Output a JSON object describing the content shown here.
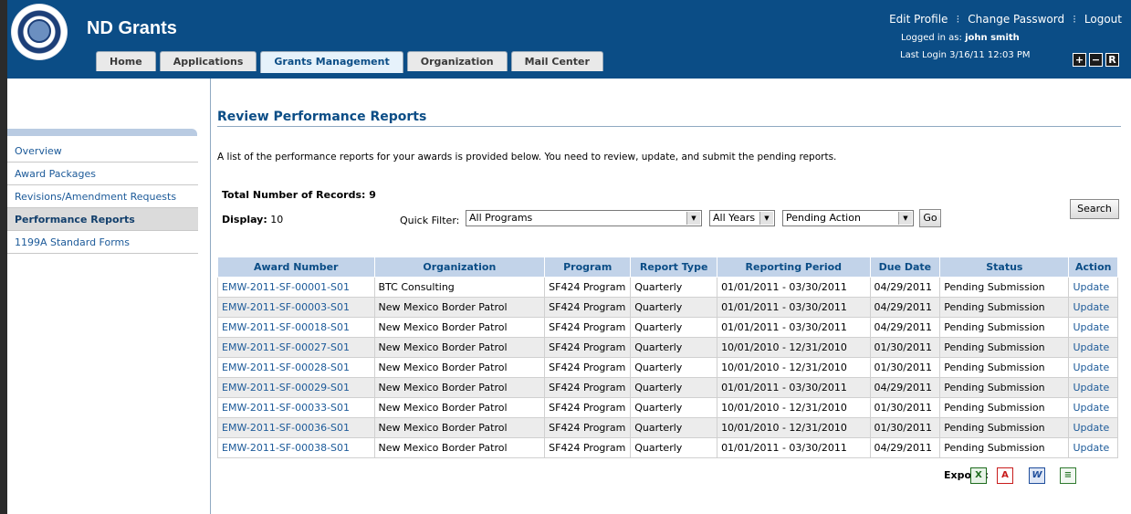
{
  "header": {
    "app_title": "ND Grants",
    "tabs": [
      {
        "label": "Home"
      },
      {
        "label": "Applications"
      },
      {
        "label": "Grants Management"
      },
      {
        "label": "Organization"
      },
      {
        "label": "Mail Center"
      }
    ],
    "active_tab": "Grants Management",
    "links": {
      "edit_profile": "Edit Profile",
      "change_password": "Change Password",
      "logout": "Logout"
    },
    "logged_in_prefix": "Logged in as:",
    "user": "john smith",
    "last_login": "Last Login 3/16/11 12:03 PM",
    "font_buttons": {
      "increase": "+",
      "decrease": "−",
      "reset": "R"
    }
  },
  "sidebar": {
    "items": [
      {
        "label": "Overview"
      },
      {
        "label": "Award Packages"
      },
      {
        "label": "Revisions/Amendment Requests"
      },
      {
        "label": "Performance Reports"
      },
      {
        "label": "1199A Standard Forms"
      }
    ],
    "active": "Performance Reports"
  },
  "main": {
    "title": "Review Performance Reports",
    "description": "A list of the performance reports for your awards is provided below. You need to review, update, and submit the pending reports.",
    "total_records": "Total Number of Records: 9",
    "display_label": "Display:",
    "display_value": "10",
    "quick_filter_label": "Quick Filter:",
    "filters": {
      "program": "All Programs",
      "year": "All Years",
      "status": "Pending Action"
    },
    "go_label": "Go",
    "search_label": "Search"
  },
  "table": {
    "columns": [
      "Award Number",
      "Organization",
      "Program",
      "Report Type",
      "Reporting Period",
      "Due Date",
      "Status",
      "Action"
    ],
    "rows": [
      [
        "EMW-2011-SF-00001-S01",
        "BTC Consulting",
        "SF424 Program",
        "Quarterly",
        "01/01/2011 - 03/30/2011",
        "04/29/2011",
        "Pending Submission",
        "Update"
      ],
      [
        "EMW-2011-SF-00003-S01",
        "New Mexico Border Patrol",
        "SF424 Program",
        "Quarterly",
        "01/01/2011 - 03/30/2011",
        "04/29/2011",
        "Pending Submission",
        "Update"
      ],
      [
        "EMW-2011-SF-00018-S01",
        "New Mexico Border Patrol",
        "SF424 Program",
        "Quarterly",
        "01/01/2011 - 03/30/2011",
        "04/29/2011",
        "Pending Submission",
        "Update"
      ],
      [
        "EMW-2011-SF-00027-S01",
        "New Mexico Border Patrol",
        "SF424 Program",
        "Quarterly",
        "10/01/2010 - 12/31/2010",
        "01/30/2011",
        "Pending Submission",
        "Update"
      ],
      [
        "EMW-2011-SF-00028-S01",
        "New Mexico Border Patrol",
        "SF424 Program",
        "Quarterly",
        "10/01/2010 - 12/31/2010",
        "01/30/2011",
        "Pending Submission",
        "Update"
      ],
      [
        "EMW-2011-SF-00029-S01",
        "New Mexico Border Patrol",
        "SF424 Program",
        "Quarterly",
        "01/01/2011 - 03/30/2011",
        "04/29/2011",
        "Pending Submission",
        "Update"
      ],
      [
        "EMW-2011-SF-00033-S01",
        "New Mexico Border Patrol",
        "SF424 Program",
        "Quarterly",
        "10/01/2010 - 12/31/2010",
        "01/30/2011",
        "Pending Submission",
        "Update"
      ],
      [
        "EMW-2011-SF-00036-S01",
        "New Mexico Border Patrol",
        "SF424 Program",
        "Quarterly",
        "10/01/2010 - 12/31/2010",
        "01/30/2011",
        "Pending Submission",
        "Update"
      ],
      [
        "EMW-2011-SF-00038-S01",
        "New Mexico Border Patrol",
        "SF424 Program",
        "Quarterly",
        "01/01/2011 - 03/30/2011",
        "04/29/2011",
        "Pending Submission",
        "Update"
      ]
    ]
  },
  "export": {
    "label": "Export :",
    "icons": [
      "excel-icon",
      "pdf-icon",
      "word-icon",
      "csv-icon"
    ]
  },
  "colors": {
    "header_bg": "#0b4d86",
    "table_header_bg": "#c2d3e9",
    "link": "#1c5a99"
  }
}
